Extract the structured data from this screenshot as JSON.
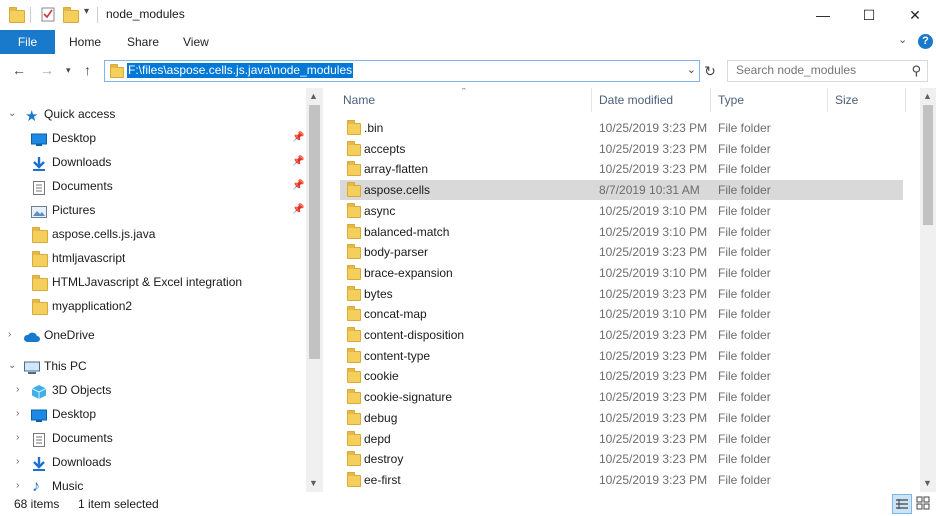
{
  "window": {
    "title": "node_modules",
    "minimize_glyph": "—",
    "maximize_glyph": "☐",
    "close_glyph": "✕"
  },
  "ribbon": {
    "tabs": [
      {
        "label": "File"
      },
      {
        "label": "Home"
      },
      {
        "label": "Share"
      },
      {
        "label": "View"
      }
    ],
    "help_glyph": "?"
  },
  "address": {
    "path": "F:\\files\\aspose.cells.js.java\\node_modules"
  },
  "search": {
    "placeholder": "Search node_modules"
  },
  "navigation": {
    "quick_access": {
      "label": "Quick access",
      "items": [
        {
          "label": "Desktop",
          "icon": "desktop-icon",
          "pinned": true
        },
        {
          "label": "Downloads",
          "icon": "downloads-icon",
          "pinned": true
        },
        {
          "label": "Documents",
          "icon": "documents-icon",
          "pinned": true
        },
        {
          "label": "Pictures",
          "icon": "pictures-icon",
          "pinned": true
        },
        {
          "label": "aspose.cells.js.java",
          "icon": "folder-icon",
          "pinned": false
        },
        {
          "label": "htmljavascript",
          "icon": "folder-icon",
          "pinned": false
        },
        {
          "label": "HTMLJavascript & Excel integration",
          "icon": "folder-icon",
          "pinned": false
        },
        {
          "label": "myapplication2",
          "icon": "folder-icon",
          "pinned": false
        }
      ]
    },
    "onedrive": {
      "label": "OneDrive"
    },
    "this_pc": {
      "label": "This PC",
      "items": [
        {
          "label": "3D Objects",
          "icon": "3d-objects-icon"
        },
        {
          "label": "Desktop",
          "icon": "desktop-icon"
        },
        {
          "label": "Documents",
          "icon": "documents-icon"
        },
        {
          "label": "Downloads",
          "icon": "downloads-icon"
        },
        {
          "label": "Music",
          "icon": "music-icon"
        }
      ]
    }
  },
  "columns": [
    {
      "label": "Name"
    },
    {
      "label": "Date modified"
    },
    {
      "label": "Type"
    },
    {
      "label": "Size"
    }
  ],
  "files": [
    {
      "name": ".bin",
      "date": "10/25/2019 3:23 PM",
      "type": "File folder"
    },
    {
      "name": "accepts",
      "date": "10/25/2019 3:23 PM",
      "type": "File folder"
    },
    {
      "name": "array-flatten",
      "date": "10/25/2019 3:23 PM",
      "type": "File folder"
    },
    {
      "name": "aspose.cells",
      "date": "8/7/2019 10:31 AM",
      "type": "File folder",
      "selected": true
    },
    {
      "name": "async",
      "date": "10/25/2019 3:10 PM",
      "type": "File folder"
    },
    {
      "name": "balanced-match",
      "date": "10/25/2019 3:10 PM",
      "type": "File folder"
    },
    {
      "name": "body-parser",
      "date": "10/25/2019 3:23 PM",
      "type": "File folder"
    },
    {
      "name": "brace-expansion",
      "date": "10/25/2019 3:10 PM",
      "type": "File folder"
    },
    {
      "name": "bytes",
      "date": "10/25/2019 3:23 PM",
      "type": "File folder"
    },
    {
      "name": "concat-map",
      "date": "10/25/2019 3:10 PM",
      "type": "File folder"
    },
    {
      "name": "content-disposition",
      "date": "10/25/2019 3:23 PM",
      "type": "File folder"
    },
    {
      "name": "content-type",
      "date": "10/25/2019 3:23 PM",
      "type": "File folder"
    },
    {
      "name": "cookie",
      "date": "10/25/2019 3:23 PM",
      "type": "File folder"
    },
    {
      "name": "cookie-signature",
      "date": "10/25/2019 3:23 PM",
      "type": "File folder"
    },
    {
      "name": "debug",
      "date": "10/25/2019 3:23 PM",
      "type": "File folder"
    },
    {
      "name": "depd",
      "date": "10/25/2019 3:23 PM",
      "type": "File folder"
    },
    {
      "name": "destroy",
      "date": "10/25/2019 3:23 PM",
      "type": "File folder"
    },
    {
      "name": "ee-first",
      "date": "10/25/2019 3:23 PM",
      "type": "File folder"
    }
  ],
  "status": {
    "item_count": "68 items",
    "selection": "1 item selected"
  },
  "colors": {
    "accent": "#1979ca",
    "selection": "#d9d9d9",
    "folder": "#f5cf5b"
  }
}
